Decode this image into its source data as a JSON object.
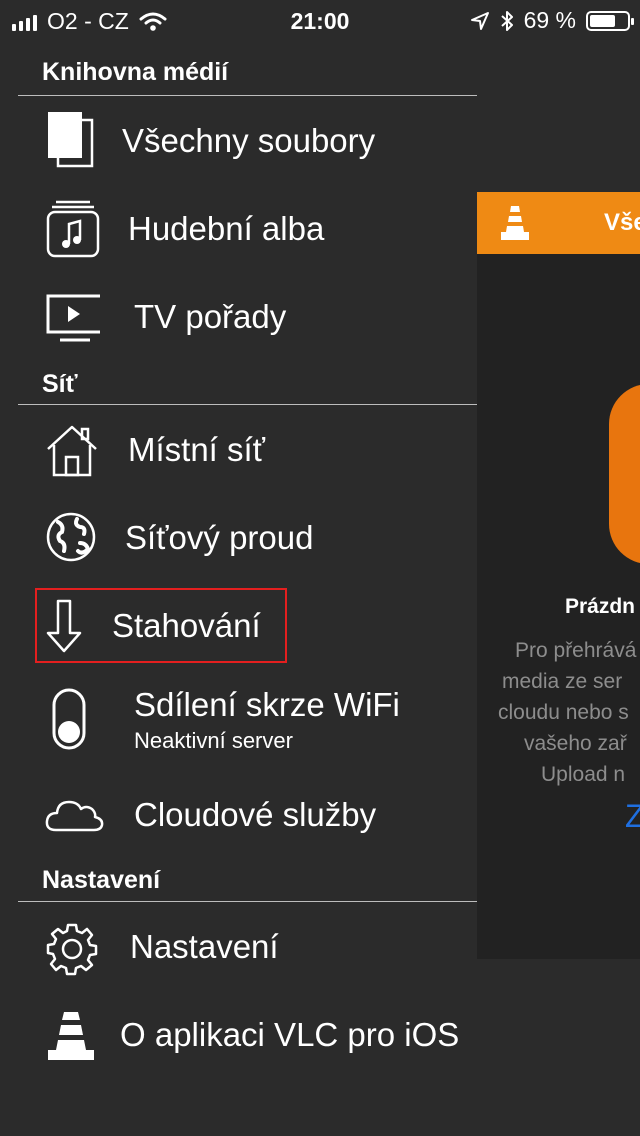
{
  "status_bar": {
    "carrier": "O2 - CZ",
    "time": "21:00",
    "battery_percent": "69 %",
    "battery_level": 0.69,
    "icons": [
      "signal-bars-icon",
      "wifi-icon",
      "location-arrow-icon",
      "bluetooth-icon",
      "battery-icon"
    ]
  },
  "sections": {
    "library": {
      "header": "Knihovna médií",
      "items": [
        {
          "label": "Všechny soubory",
          "icon": "all-files-icon"
        },
        {
          "label": "Hudební alba",
          "icon": "music-album-icon"
        },
        {
          "label": "TV pořady",
          "icon": "tv-icon"
        }
      ]
    },
    "network": {
      "header": "Síť",
      "items": [
        {
          "label": "Místní síť",
          "icon": "home-network-icon"
        },
        {
          "label": "Síťový proud",
          "icon": "globe-icon"
        },
        {
          "label": "Stahování",
          "icon": "download-arrow-icon"
        },
        {
          "label": "Sdílení skrze WiFi",
          "sublabel": "Neaktivní server",
          "icon": "toggle-switch-icon"
        },
        {
          "label": "Cloudové služby",
          "icon": "cloud-icon"
        }
      ]
    },
    "settings": {
      "header": "Nastavení",
      "items": [
        {
          "label": "Nastavení",
          "icon": "gear-icon"
        },
        {
          "label": "O aplikaci VLC pro iOS",
          "icon": "vlc-cone-icon"
        }
      ]
    }
  },
  "right_panel": {
    "title": "Vše",
    "empty_title": "Prázdn",
    "description_lines": [
      "Pro přehrává",
      "media ze ser",
      "cloudu nebo s",
      "vašeho zař",
      "Upload n"
    ],
    "link": "Z",
    "colors": {
      "accent": "#ef8a14",
      "art": "#e8750e",
      "link": "#1f6fe0"
    }
  },
  "highlight_color": "#e41f1f"
}
